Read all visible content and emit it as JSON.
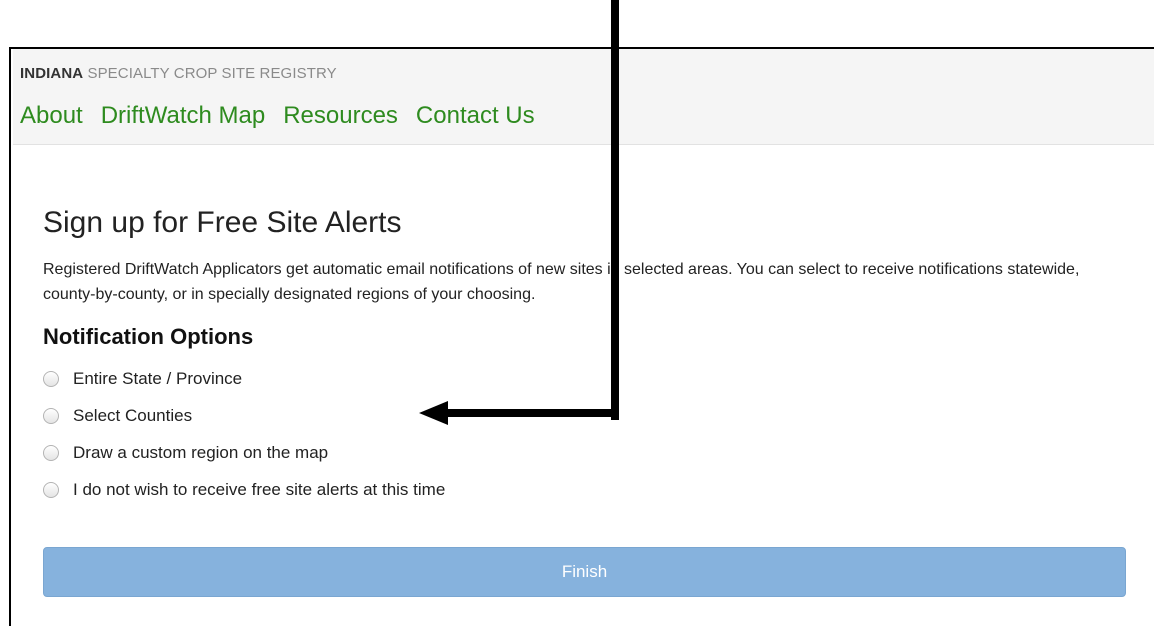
{
  "header": {
    "brand_strong": "INDIANA",
    "brand_light": " SPECIALTY CROP SITE REGISTRY",
    "nav": [
      {
        "label": "About"
      },
      {
        "label": "DriftWatch Map"
      },
      {
        "label": "Resources"
      },
      {
        "label": "Contact Us"
      }
    ]
  },
  "main": {
    "title": "Sign up for Free Site Alerts",
    "description": "Registered DriftWatch Applicators get automatic email notifications of new sites in selected areas. You can select to receive notifications statewide, county-by-county, or in specially designated regions of your choosing.",
    "subtitle": "Notification Options",
    "options": [
      {
        "label": "Entire State / Province",
        "selected": false
      },
      {
        "label": "Select Counties",
        "selected": false
      },
      {
        "label": "Draw a custom region on the map",
        "selected": false
      },
      {
        "label": "I do not wish to receive free site alerts at this time",
        "selected": false
      }
    ],
    "finish_label": "Finish"
  },
  "colors": {
    "nav_link": "#2e8b1f",
    "finish_button": "#86b2dd",
    "header_background": "#f5f5f5",
    "arrow": "#000000"
  },
  "annotation": {
    "arrow_icon": "arrow-left-icon"
  }
}
